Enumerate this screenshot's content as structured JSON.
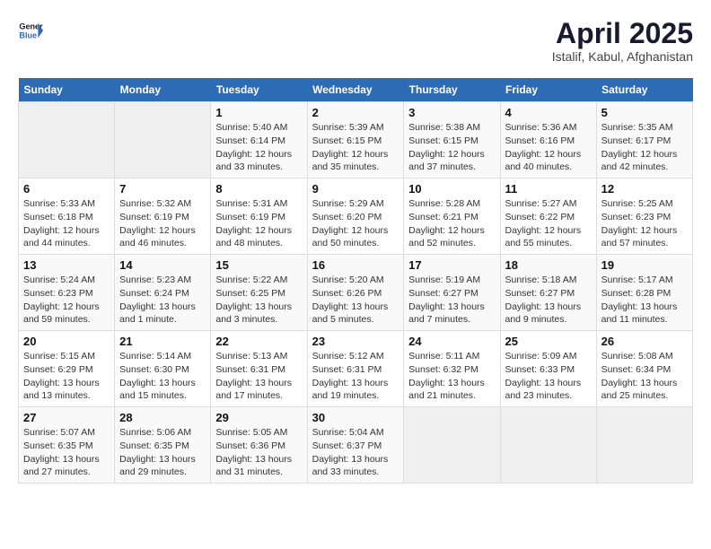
{
  "header": {
    "logo_line1": "General",
    "logo_line2": "Blue",
    "month_year": "April 2025",
    "location": "Istalif, Kabul, Afghanistan"
  },
  "weekdays": [
    "Sunday",
    "Monday",
    "Tuesday",
    "Wednesday",
    "Thursday",
    "Friday",
    "Saturday"
  ],
  "weeks": [
    [
      {
        "num": "",
        "detail": ""
      },
      {
        "num": "",
        "detail": ""
      },
      {
        "num": "1",
        "detail": "Sunrise: 5:40 AM\nSunset: 6:14 PM\nDaylight: 12 hours\nand 33 minutes."
      },
      {
        "num": "2",
        "detail": "Sunrise: 5:39 AM\nSunset: 6:15 PM\nDaylight: 12 hours\nand 35 minutes."
      },
      {
        "num": "3",
        "detail": "Sunrise: 5:38 AM\nSunset: 6:15 PM\nDaylight: 12 hours\nand 37 minutes."
      },
      {
        "num": "4",
        "detail": "Sunrise: 5:36 AM\nSunset: 6:16 PM\nDaylight: 12 hours\nand 40 minutes."
      },
      {
        "num": "5",
        "detail": "Sunrise: 5:35 AM\nSunset: 6:17 PM\nDaylight: 12 hours\nand 42 minutes."
      }
    ],
    [
      {
        "num": "6",
        "detail": "Sunrise: 5:33 AM\nSunset: 6:18 PM\nDaylight: 12 hours\nand 44 minutes."
      },
      {
        "num": "7",
        "detail": "Sunrise: 5:32 AM\nSunset: 6:19 PM\nDaylight: 12 hours\nand 46 minutes."
      },
      {
        "num": "8",
        "detail": "Sunrise: 5:31 AM\nSunset: 6:19 PM\nDaylight: 12 hours\nand 48 minutes."
      },
      {
        "num": "9",
        "detail": "Sunrise: 5:29 AM\nSunset: 6:20 PM\nDaylight: 12 hours\nand 50 minutes."
      },
      {
        "num": "10",
        "detail": "Sunrise: 5:28 AM\nSunset: 6:21 PM\nDaylight: 12 hours\nand 52 minutes."
      },
      {
        "num": "11",
        "detail": "Sunrise: 5:27 AM\nSunset: 6:22 PM\nDaylight: 12 hours\nand 55 minutes."
      },
      {
        "num": "12",
        "detail": "Sunrise: 5:25 AM\nSunset: 6:23 PM\nDaylight: 12 hours\nand 57 minutes."
      }
    ],
    [
      {
        "num": "13",
        "detail": "Sunrise: 5:24 AM\nSunset: 6:23 PM\nDaylight: 12 hours\nand 59 minutes."
      },
      {
        "num": "14",
        "detail": "Sunrise: 5:23 AM\nSunset: 6:24 PM\nDaylight: 13 hours\nand 1 minute."
      },
      {
        "num": "15",
        "detail": "Sunrise: 5:22 AM\nSunset: 6:25 PM\nDaylight: 13 hours\nand 3 minutes."
      },
      {
        "num": "16",
        "detail": "Sunrise: 5:20 AM\nSunset: 6:26 PM\nDaylight: 13 hours\nand 5 minutes."
      },
      {
        "num": "17",
        "detail": "Sunrise: 5:19 AM\nSunset: 6:27 PM\nDaylight: 13 hours\nand 7 minutes."
      },
      {
        "num": "18",
        "detail": "Sunrise: 5:18 AM\nSunset: 6:27 PM\nDaylight: 13 hours\nand 9 minutes."
      },
      {
        "num": "19",
        "detail": "Sunrise: 5:17 AM\nSunset: 6:28 PM\nDaylight: 13 hours\nand 11 minutes."
      }
    ],
    [
      {
        "num": "20",
        "detail": "Sunrise: 5:15 AM\nSunset: 6:29 PM\nDaylight: 13 hours\nand 13 minutes."
      },
      {
        "num": "21",
        "detail": "Sunrise: 5:14 AM\nSunset: 6:30 PM\nDaylight: 13 hours\nand 15 minutes."
      },
      {
        "num": "22",
        "detail": "Sunrise: 5:13 AM\nSunset: 6:31 PM\nDaylight: 13 hours\nand 17 minutes."
      },
      {
        "num": "23",
        "detail": "Sunrise: 5:12 AM\nSunset: 6:31 PM\nDaylight: 13 hours\nand 19 minutes."
      },
      {
        "num": "24",
        "detail": "Sunrise: 5:11 AM\nSunset: 6:32 PM\nDaylight: 13 hours\nand 21 minutes."
      },
      {
        "num": "25",
        "detail": "Sunrise: 5:09 AM\nSunset: 6:33 PM\nDaylight: 13 hours\nand 23 minutes."
      },
      {
        "num": "26",
        "detail": "Sunrise: 5:08 AM\nSunset: 6:34 PM\nDaylight: 13 hours\nand 25 minutes."
      }
    ],
    [
      {
        "num": "27",
        "detail": "Sunrise: 5:07 AM\nSunset: 6:35 PM\nDaylight: 13 hours\nand 27 minutes."
      },
      {
        "num": "28",
        "detail": "Sunrise: 5:06 AM\nSunset: 6:35 PM\nDaylight: 13 hours\nand 29 minutes."
      },
      {
        "num": "29",
        "detail": "Sunrise: 5:05 AM\nSunset: 6:36 PM\nDaylight: 13 hours\nand 31 minutes."
      },
      {
        "num": "30",
        "detail": "Sunrise: 5:04 AM\nSunset: 6:37 PM\nDaylight: 13 hours\nand 33 minutes."
      },
      {
        "num": "",
        "detail": ""
      },
      {
        "num": "",
        "detail": ""
      },
      {
        "num": "",
        "detail": ""
      }
    ]
  ]
}
